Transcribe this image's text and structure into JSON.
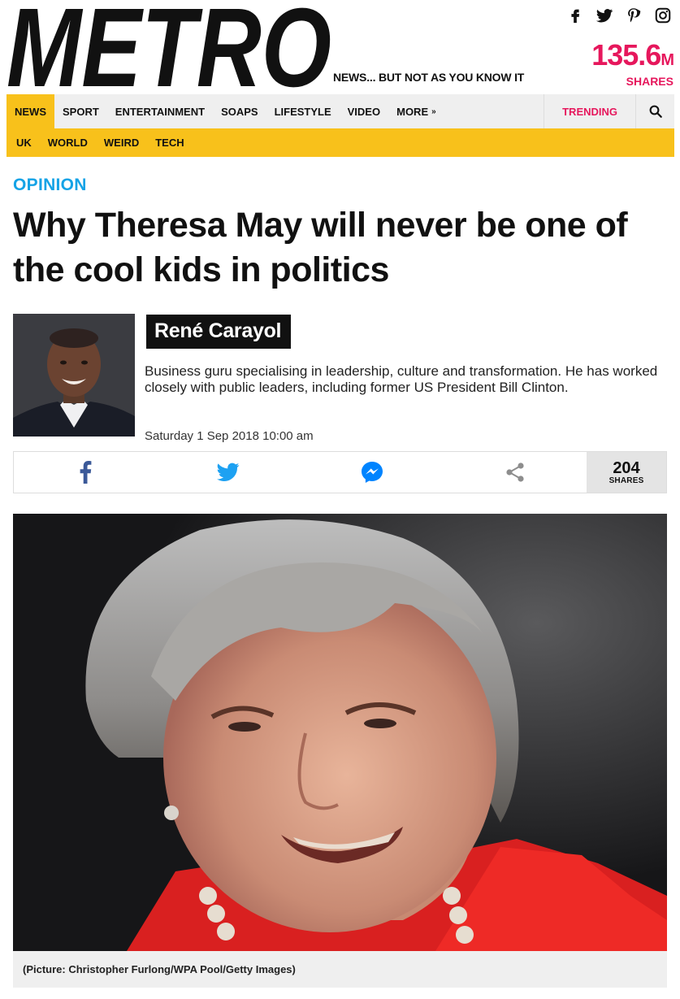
{
  "header": {
    "logo_text": "METRO",
    "tagline": "NEWS... BUT NOT AS YOU KNOW IT",
    "social_icons": [
      "facebook-icon",
      "twitter-icon",
      "pinterest-icon",
      "instagram-icon"
    ],
    "shares_number": "135.6",
    "shares_suffix": "M",
    "shares_label": "SHARES"
  },
  "nav": {
    "primary": [
      "NEWS",
      "SPORT",
      "ENTERTAINMENT",
      "SOAPS",
      "LIFESTYLE",
      "VIDEO"
    ],
    "more_label": "MORE",
    "trending_label": "TRENDING",
    "secondary": [
      "UK",
      "WORLD",
      "WEIRD",
      "TECH"
    ],
    "active_color": "#f8c11b"
  },
  "article": {
    "kicker": "OPINION",
    "headline": "Why Theresa May will never be one of the cool kids in politics",
    "author_name": "René Carayol",
    "author_bio": "Business guru specialising in leadership, culture and transformation. He has worked closely with public leaders, including former US President Bill Clinton.",
    "date": "Saturday 1 Sep 2018 10:00 am",
    "share_icons": [
      "facebook-icon",
      "twitter-icon",
      "messenger-icon",
      "share-icon"
    ],
    "share_total": "204",
    "share_total_label": "SHARES",
    "caption": "(Picture: Christopher Furlong/WPA Pool/Getty Images)"
  },
  "colors": {
    "brand_pink": "#e6175c",
    "kicker_blue": "#15a3e6",
    "facebook_blue": "#3b5998",
    "twitter_blue": "#1da1f2",
    "messenger_blue": "#0084ff"
  }
}
